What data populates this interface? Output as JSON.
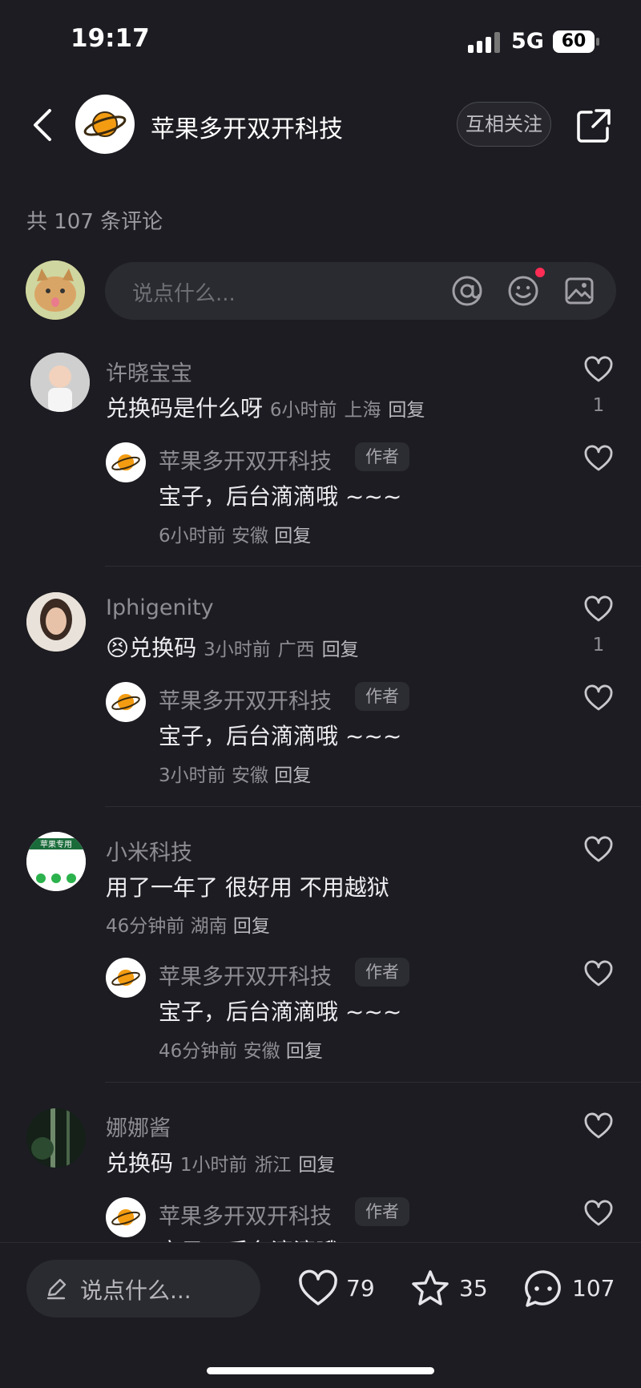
{
  "status_bar": {
    "time": "19:17",
    "network": "5G",
    "battery": "60"
  },
  "header": {
    "title": "苹果多开双开科技",
    "follow_label": "互相关注"
  },
  "comment_count_text": "共 107 条评论",
  "composer": {
    "placeholder": "说点什么..."
  },
  "comments": [
    {
      "user": "许晓宝宝",
      "text": "兑换码是什么呀",
      "time": "6小时前",
      "location": "上海",
      "reply_label": "回复",
      "likes": "1",
      "reply": {
        "user": "苹果多开双开科技",
        "badge": "作者",
        "text": "宝子，后台滴滴哦 ~~~",
        "time": "6小时前",
        "location": "安徽",
        "reply_label": "回复"
      }
    },
    {
      "user": "Iphigenity",
      "text": "兑换码",
      "time": "3小时前",
      "location": "广西",
      "reply_label": "回复",
      "likes": "1",
      "reply": {
        "user": "苹果多开双开科技",
        "badge": "作者",
        "text": "宝子，后台滴滴哦 ~~~",
        "time": "3小时前",
        "location": "安徽",
        "reply_label": "回复"
      }
    },
    {
      "user": "小米科技",
      "text": "用了一年了 很好用 不用越狱",
      "time": "46分钟前",
      "location": "湖南",
      "reply_label": "回复",
      "likes": "",
      "reply": {
        "user": "苹果多开双开科技",
        "badge": "作者",
        "text": "宝子，后台滴滴哦 ~~~",
        "time": "46分钟前",
        "location": "安徽",
        "reply_label": "回复"
      }
    },
    {
      "user": "娜娜酱",
      "text": "兑换码",
      "time": "1小时前",
      "location": "浙江",
      "reply_label": "回复",
      "likes": "",
      "reply": {
        "user": "苹果多开双开科技",
        "badge": "作者",
        "text": "宝子，后台滴滴哦",
        "time": "",
        "location": "",
        "reply_label": ""
      }
    }
  ],
  "avatar3_text": "苹果专用",
  "bottom_bar": {
    "placeholder": "说点什么...",
    "likes": "79",
    "favorites": "35",
    "comments": "107"
  },
  "colors": {
    "background": "#1c1c22",
    "accent_dot": "#ff2d55",
    "brand_orange": "#f39c12"
  }
}
